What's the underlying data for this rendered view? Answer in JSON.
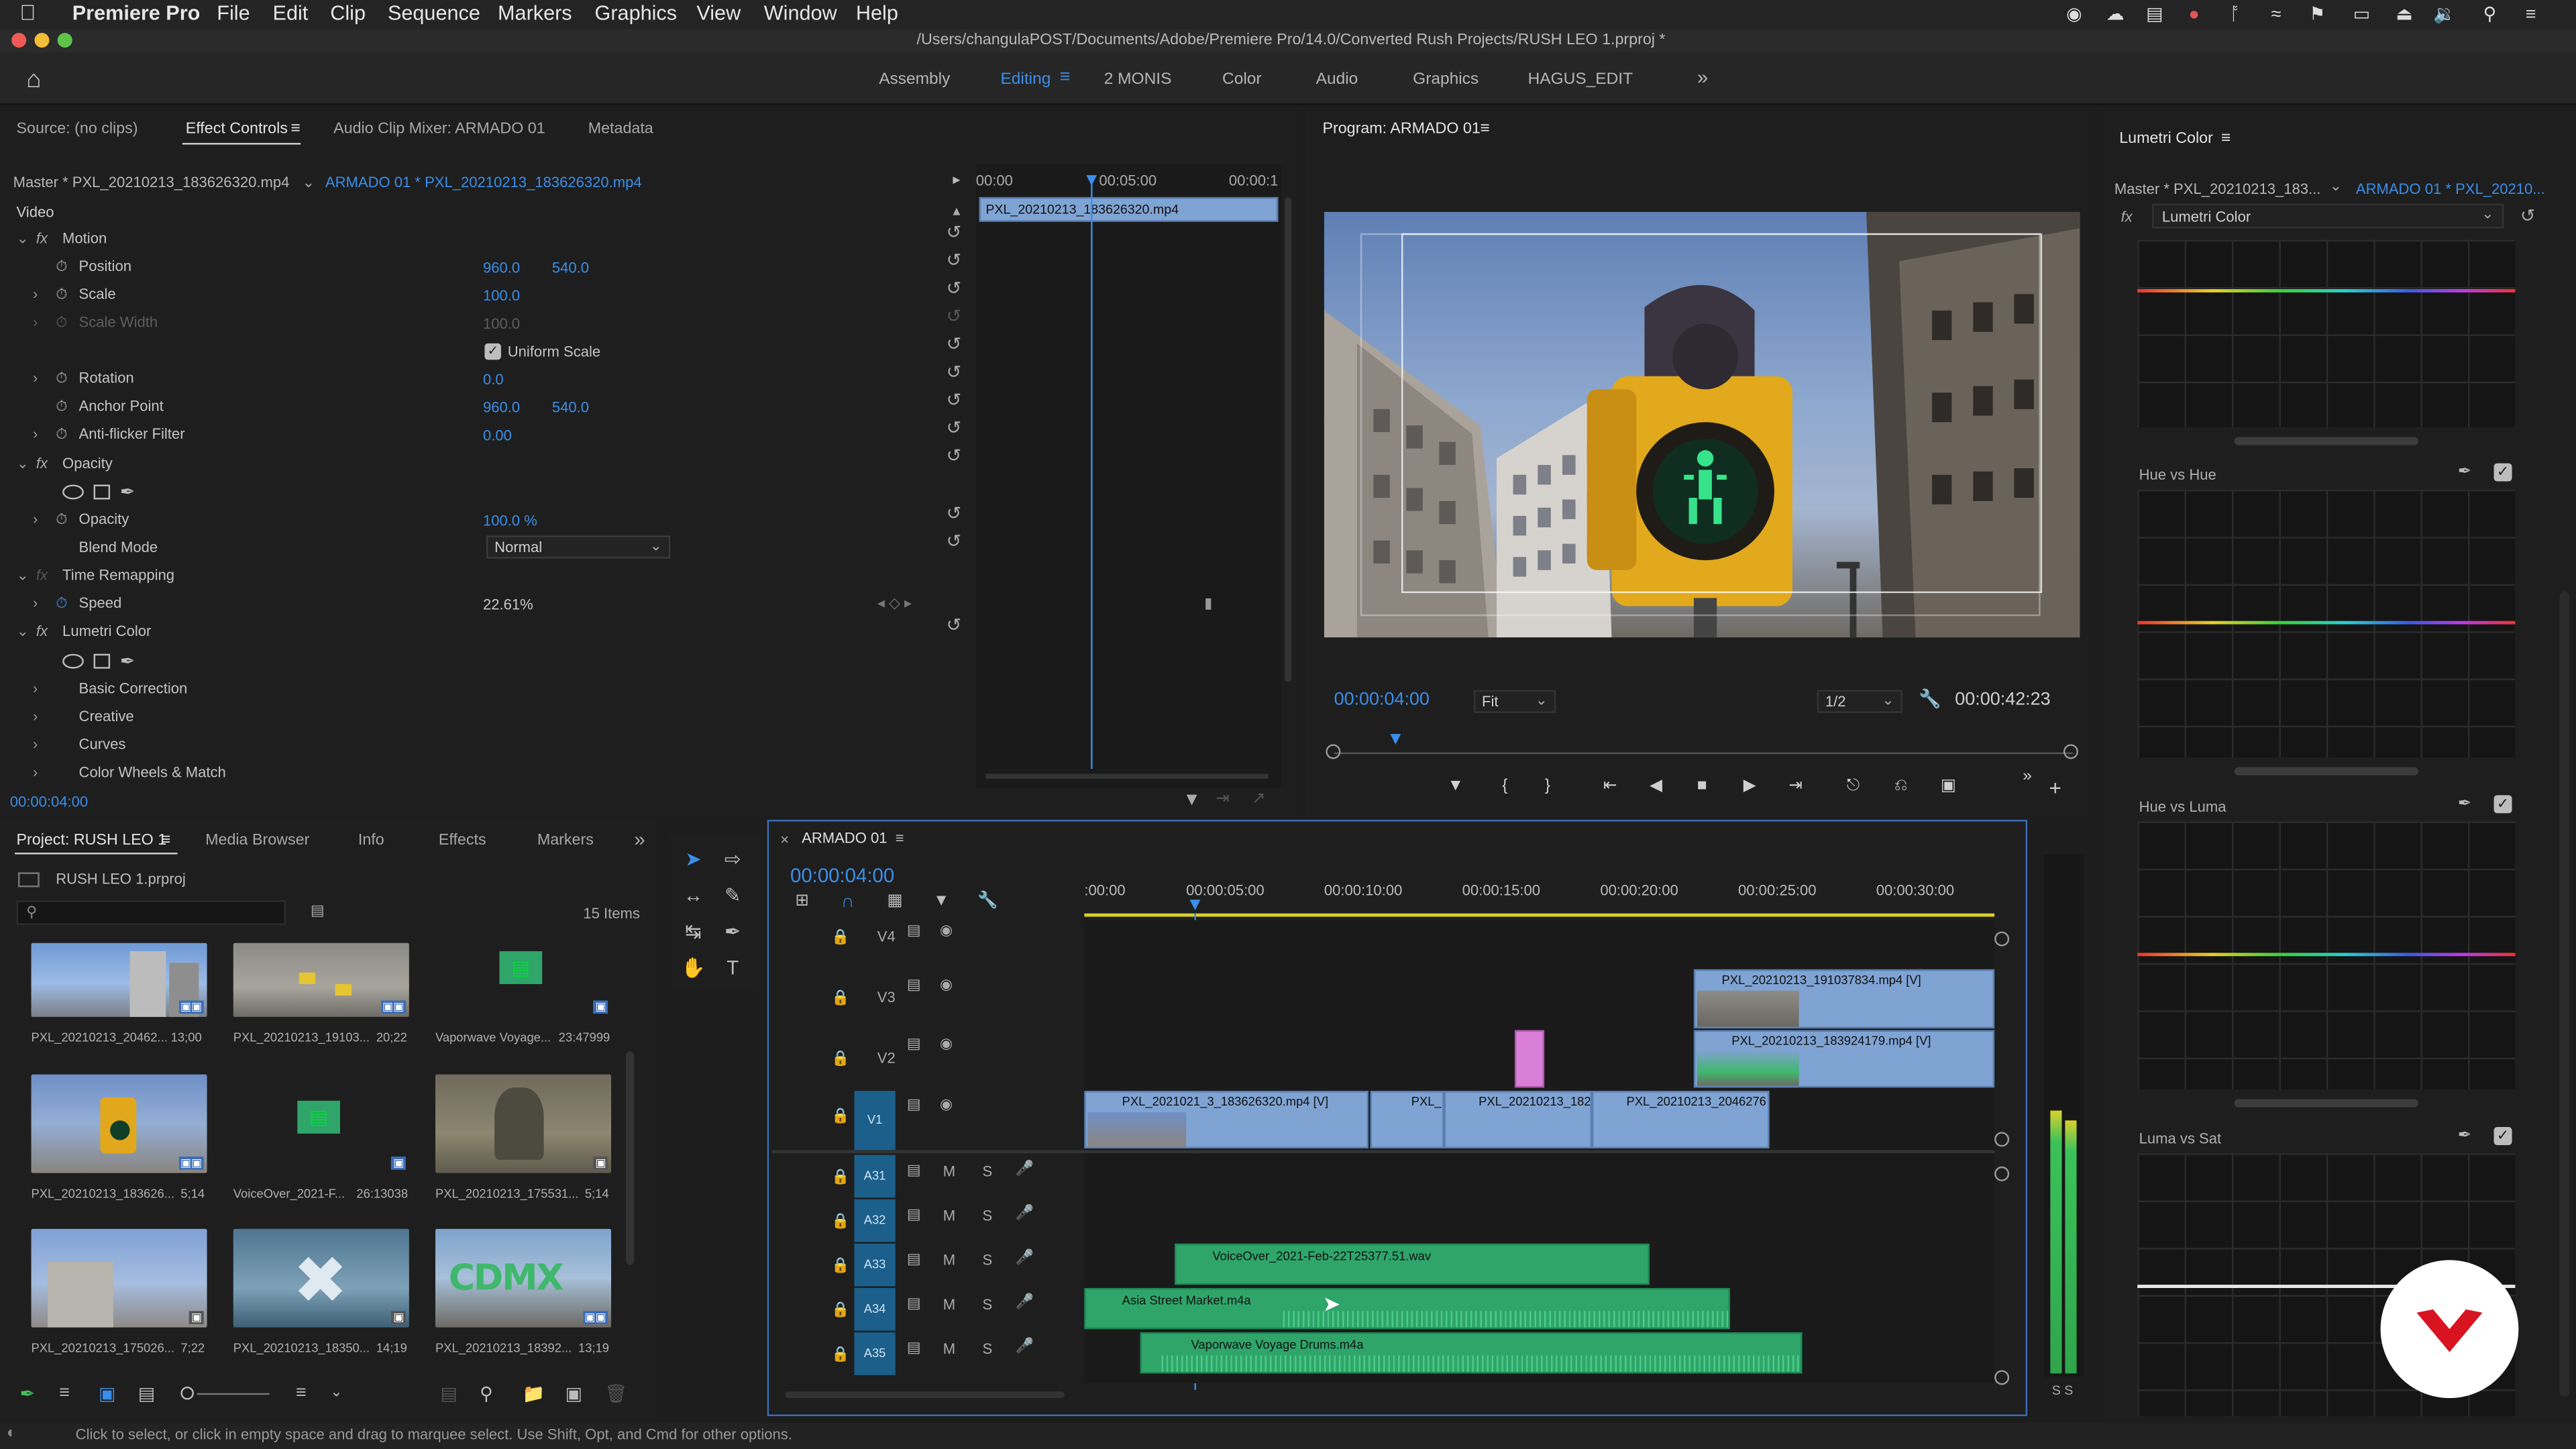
{
  "menubar": {
    "app_name": "Premiere Pro",
    "items": [
      "File",
      "Edit",
      "Clip",
      "Sequence",
      "Markers",
      "Graphics",
      "View",
      "Window",
      "Help"
    ]
  },
  "window": {
    "title": "/Users/changulaPOST/Documents/Adobe/Premiere Pro/14.0/Converted Rush Projects/RUSH LEO 1.prproj *"
  },
  "workspaces": {
    "items": [
      "Assembly",
      "Editing",
      "2 MONIS",
      "Color",
      "Audio",
      "Graphics",
      "HAGUS_EDIT"
    ],
    "active": "Editing",
    "more": "»"
  },
  "source_panel": {
    "tabs": [
      "Source: (no clips)",
      "Effect Controls",
      "Audio Clip Mixer: ARMADO 01",
      "Metadata"
    ],
    "active_tab": "Effect Controls",
    "master_clip": "Master * PXL_20210213_183626320.mp4",
    "sequence_clip": "ARMADO 01 * PXL_20210213_183626320.mp4",
    "section_video": "Video",
    "ruler": [
      "00:00",
      "00:05:00",
      "00:00:1"
    ],
    "mini_clip": "PXL_20210213_183626320.mp4",
    "rows": {
      "motion": "Motion",
      "position": "Position",
      "position_x": "960.0",
      "position_y": "540.0",
      "scale": "Scale",
      "scale_val": "100.0",
      "scale_width": "Scale Width",
      "scale_width_val": "100.0",
      "uniform_scale": "Uniform Scale",
      "rotation": "Rotation",
      "rotation_val": "0.0",
      "anchor": "Anchor Point",
      "anchor_x": "960.0",
      "anchor_y": "540.0",
      "antiflicker": "Anti-flicker Filter",
      "antiflicker_val": "0.00",
      "opacity_fx": "Opacity",
      "opacity": "Opacity",
      "opacity_val": "100.0 %",
      "blend_mode": "Blend Mode",
      "blend_val": "Normal",
      "time_remap": "Time Remapping",
      "speed": "Speed",
      "speed_val": "22.61%",
      "lumetri": "Lumetri Color",
      "basic": "Basic Correction",
      "creative": "Creative",
      "curves": "Curves",
      "wheels": "Color Wheels & Match"
    },
    "timecode": "00:00:04:00"
  },
  "program": {
    "title": "Program: ARMADO 01",
    "timecode": "00:00:04:00",
    "fit": "Fit",
    "resolution": "1/2",
    "duration": "00:00:42:23"
  },
  "lumetri": {
    "title": "Lumetri Color",
    "master": "Master * PXL_20210213_183...",
    "sequence": "ARMADO 01 * PXL_20210...",
    "effect": "Lumetri Color",
    "curves": [
      "Hue vs Hue",
      "Hue vs Luma",
      "Luma vs Sat"
    ]
  },
  "project": {
    "tabs": [
      "Project: RUSH LEO 1",
      "Media Browser",
      "Info",
      "Effects",
      "Markers"
    ],
    "file": "RUSH LEO 1.prproj",
    "count": "15 Items",
    "items": [
      {
        "name": "PXL_20210213_20462...",
        "dur": "13;00"
      },
      {
        "name": "PXL_20210213_19103...",
        "dur": "20;22"
      },
      {
        "name": "Vaporwave Voyage...",
        "dur": "23:47999"
      },
      {
        "name": "PXL_20210213_183626...",
        "dur": "5;14"
      },
      {
        "name": "VoiceOver_2021-F...",
        "dur": "26:13038"
      },
      {
        "name": "PXL_20210213_175531...",
        "dur": "5;14"
      },
      {
        "name": "PXL_20210213_175026...",
        "dur": "7;22"
      },
      {
        "name": "PXL_20210213_18350...",
        "dur": "14;19"
      },
      {
        "name": "PXL_20210213_18392...",
        "dur": "13;19"
      }
    ]
  },
  "timeline": {
    "tab": "ARMADO 01",
    "timecode": "00:00:04:00",
    "ruler": [
      ":00:00",
      "00:00:05:00",
      "00:00:10:00",
      "00:00:15:00",
      "00:00:20:00",
      "00:00:25:00",
      "00:00:30:00"
    ],
    "video_tracks": [
      "V4",
      "V3",
      "V2",
      "V1"
    ],
    "audio_tracks": [
      "A31",
      "A32",
      "A33",
      "A34",
      "A35"
    ],
    "clips": {
      "v3": "PXL_20210213_191037834.mp4 [V]",
      "v2": "PXL_20210213_183924179.mp4 [V]",
      "v1a": "PXL_2021021_3_183626320.mp4 [V]",
      "v1b": "PXL_",
      "v1c": "PXL_20210213_182",
      "v1d": "PXL_20210213_2046276",
      "a33": "VoiceOver_2021-Feb-22T25377.51.wav",
      "a34": "Asia Street Market.m4a",
      "a35": "Vaporwave Voyage Drums.m4a"
    },
    "mute": "M",
    "solo": "S"
  },
  "meters": {
    "labels": "S S"
  },
  "status_bar": {
    "text": "Click to select, or click in empty space and drag to marquee select. Use Shift, Opt, and Cmd for other options."
  }
}
